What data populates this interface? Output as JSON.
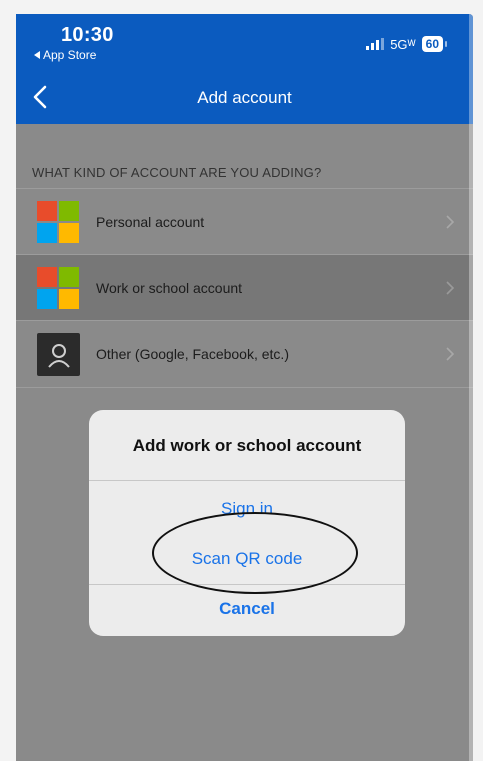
{
  "status_bar": {
    "time": "10:30",
    "back_app": "App Store",
    "network": "5Gᵂ",
    "battery": "60"
  },
  "nav": {
    "title": "Add account"
  },
  "account_list": {
    "section_label": "WHAT KIND OF ACCOUNT ARE YOU ADDING?",
    "items": [
      {
        "label": "Personal account",
        "icon": "microsoft-logo"
      },
      {
        "label": "Work or school account",
        "icon": "microsoft-logo"
      },
      {
        "label": "Other (Google, Facebook, etc.)",
        "icon": "person-icon"
      }
    ]
  },
  "dialog": {
    "title": "Add work or school account",
    "sign_in": "Sign in",
    "scan_qr": "Scan QR code",
    "cancel": "Cancel"
  },
  "colors": {
    "header_blue": "#0b5bbf",
    "link_blue": "#1a73e8",
    "ms_red": "#e84c2b",
    "ms_green": "#7fba00",
    "ms_blue": "#00a4ef",
    "ms_yellow": "#ffb900"
  }
}
